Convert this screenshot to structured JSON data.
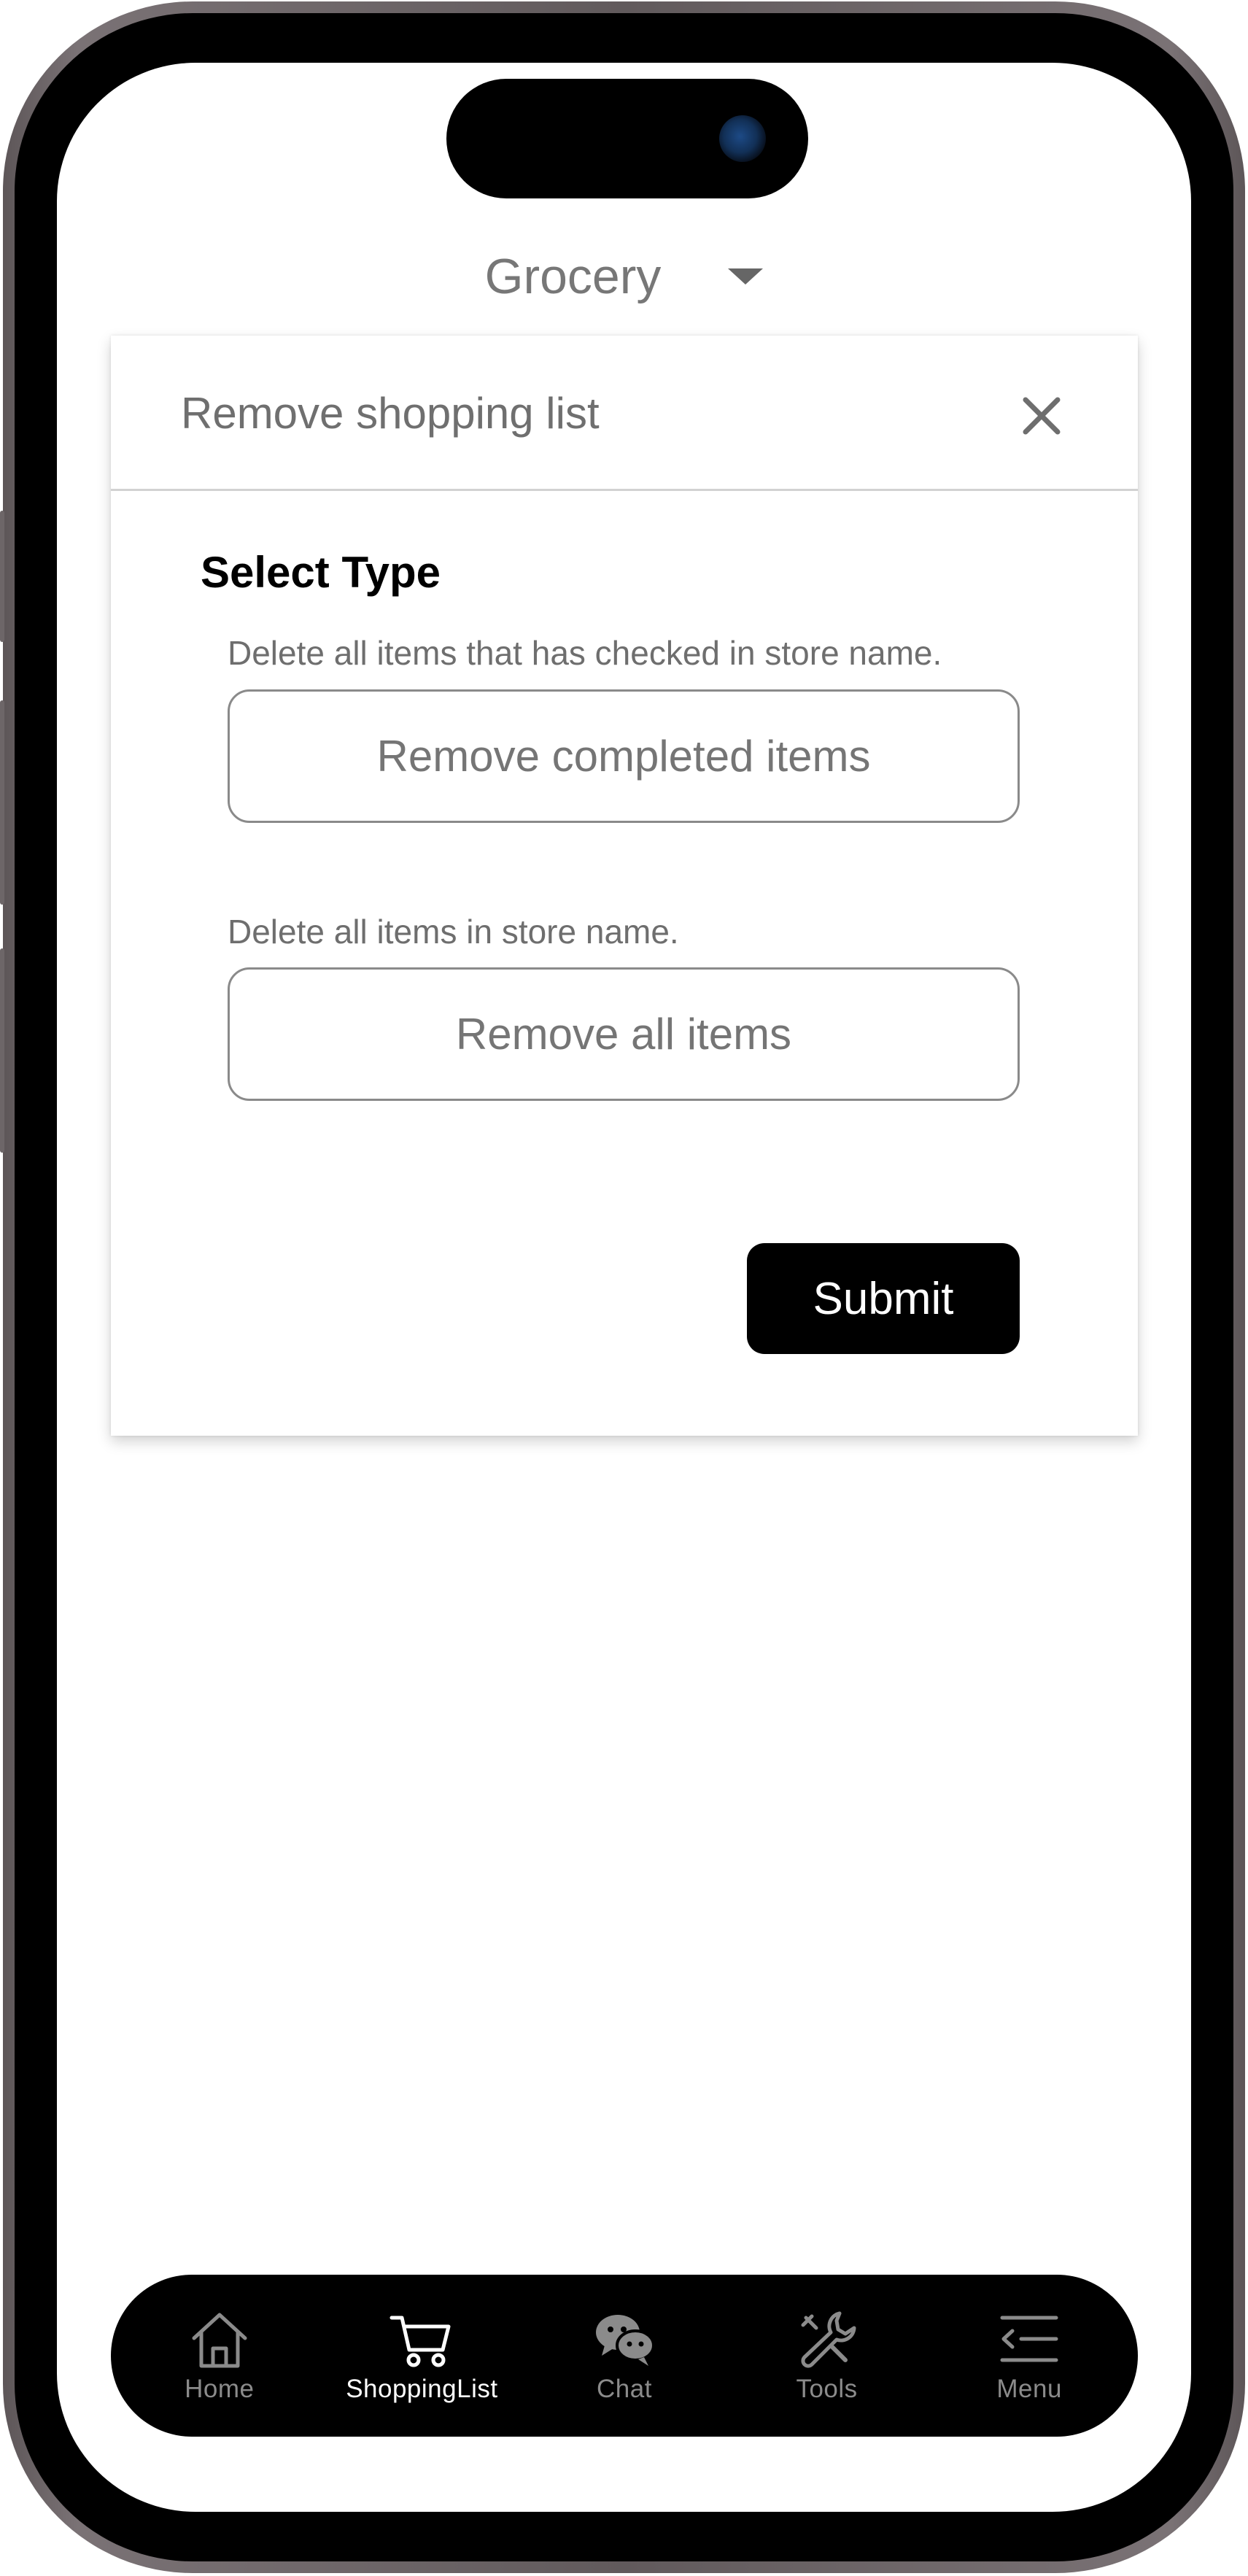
{
  "header": {
    "title": "Grocery"
  },
  "dialog": {
    "title": "Remove shopping list",
    "section_title": "Select Type",
    "options": [
      {
        "description": "Delete all items that has checked in store name.",
        "label": "Remove completed items"
      },
      {
        "description": "Delete all items in store name.",
        "label": "Remove all items"
      }
    ],
    "submit_label": "Submit"
  },
  "tabbar": {
    "items": [
      {
        "label": "Home",
        "icon": "home-icon",
        "active": false
      },
      {
        "label": "ShoppingList",
        "icon": "cart-icon",
        "active": true
      },
      {
        "label": "Chat",
        "icon": "chat-icon",
        "active": false
      },
      {
        "label": "Tools",
        "icon": "wrench-icon",
        "active": false
      },
      {
        "label": "Menu",
        "icon": "menu-icon",
        "active": false
      }
    ]
  },
  "colors": {
    "accent": "#000000",
    "inactive_tab": "#8b8b8b",
    "active_tab": "#ffffff"
  }
}
